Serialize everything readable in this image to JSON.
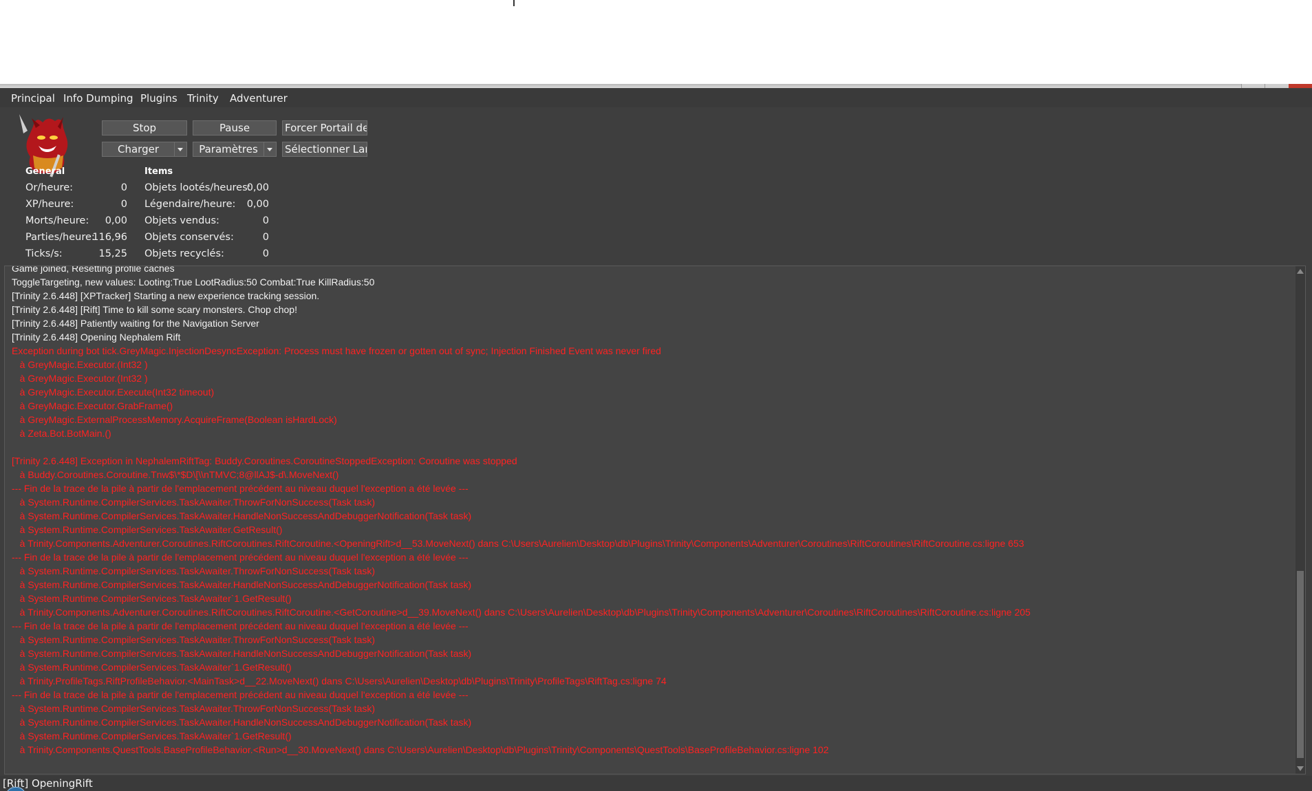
{
  "menu": [
    "Principal",
    "Info Dumping",
    "Plugins",
    "Trinity",
    "Adventurer"
  ],
  "toolbar": {
    "stop": "Stop",
    "pause": "Pause",
    "force_portal": "Forcer Portail de V",
    "load": "Charger",
    "settings": "Paramètres",
    "language": "Sélectionner Langa"
  },
  "stats": {
    "general_header": "General",
    "items_header": "Items",
    "general": [
      {
        "label": "Or/heure:",
        "value": "0"
      },
      {
        "label": "XP/heure:",
        "value": "0"
      },
      {
        "label": "Morts/heure:",
        "value": "0,00"
      },
      {
        "label": "Parties/heure:",
        "value": "116,96"
      },
      {
        "label": "Ticks/s:",
        "value": "15,25"
      }
    ],
    "items": [
      {
        "label": "Objets lootés/heures:",
        "value": "0,00"
      },
      {
        "label": "Légendaire/heure:",
        "value": "0,00"
      },
      {
        "label": "Objets vendus:",
        "value": "0"
      },
      {
        "label": "Objets conservés:",
        "value": "0"
      },
      {
        "label": "Objets recyclés:",
        "value": "0"
      }
    ]
  },
  "log": [
    {
      "level": "info",
      "text": "Game joined, Resetting profile caches"
    },
    {
      "level": "info",
      "text": "ToggleTargeting, new values: Looting:True LootRadius:50 Combat:True KillRadius:50"
    },
    {
      "level": "info",
      "text": "[Trinity 2.6.448] [XPTracker] Starting a new experience tracking session."
    },
    {
      "level": "info",
      "text": "[Trinity 2.6.448] [Rift] Time to kill some scary monsters. Chop chop!"
    },
    {
      "level": "info",
      "text": "[Trinity 2.6.448] Patiently waiting for the Navigation Server"
    },
    {
      "level": "info",
      "text": "[Trinity 2.6.448] Opening Nephalem Rift"
    },
    {
      "level": "err",
      "text": "Exception during bot tick.GreyMagic.InjectionDesyncException: Process must have frozen or gotten out of sync; Injection Finished Event was never fired"
    },
    {
      "level": "err",
      "text": "   à GreyMagic.Executor.(Int32 )"
    },
    {
      "level": "err",
      "text": "   à GreyMagic.Executor.(Int32 )"
    },
    {
      "level": "err",
      "text": "   à GreyMagic.Executor.Execute(Int32 timeout)"
    },
    {
      "level": "err",
      "text": "   à GreyMagic.Executor.GrabFrame()"
    },
    {
      "level": "err",
      "text": "   à GreyMagic.ExternalProcessMemory.AcquireFrame(Boolean isHardLock)"
    },
    {
      "level": "err",
      "text": "   à Zeta.Bot.BotMain.()"
    },
    {
      "level": "err",
      "text": ""
    },
    {
      "level": "err",
      "text": "[Trinity 2.6.448] Exception in NephalemRiftTag: Buddy.Coroutines.CoroutineStoppedException: Coroutine was stopped"
    },
    {
      "level": "err",
      "text": "   à Buddy.Coroutines.Coroutine.Tnw$\\*$D\\[\\\\nTMVC;8@llAJ$-d\\.MoveNext()"
    },
    {
      "level": "err",
      "text": "--- Fin de la trace de la pile à partir de l'emplacement précédent au niveau duquel l'exception a été levée ---"
    },
    {
      "level": "err",
      "text": "   à System.Runtime.CompilerServices.TaskAwaiter.ThrowForNonSuccess(Task task)"
    },
    {
      "level": "err",
      "text": "   à System.Runtime.CompilerServices.TaskAwaiter.HandleNonSuccessAndDebuggerNotification(Task task)"
    },
    {
      "level": "err",
      "text": "   à System.Runtime.CompilerServices.TaskAwaiter.GetResult()"
    },
    {
      "level": "err",
      "text": "   à Trinity.Components.Adventurer.Coroutines.RiftCoroutines.RiftCoroutine.<OpeningRift>d__53.MoveNext() dans C:\\Users\\Aurelien\\Desktop\\db\\Plugins\\Trinity\\Components\\Adventurer\\Coroutines\\RiftCoroutines\\RiftCoroutine.cs:ligne 653"
    },
    {
      "level": "err",
      "text": "--- Fin de la trace de la pile à partir de l'emplacement précédent au niveau duquel l'exception a été levée ---"
    },
    {
      "level": "err",
      "text": "   à System.Runtime.CompilerServices.TaskAwaiter.ThrowForNonSuccess(Task task)"
    },
    {
      "level": "err",
      "text": "   à System.Runtime.CompilerServices.TaskAwaiter.HandleNonSuccessAndDebuggerNotification(Task task)"
    },
    {
      "level": "err",
      "text": "   à System.Runtime.CompilerServices.TaskAwaiter`1.GetResult()"
    },
    {
      "level": "err",
      "text": "   à Trinity.Components.Adventurer.Coroutines.RiftCoroutines.RiftCoroutine.<GetCoroutine>d__39.MoveNext() dans C:\\Users\\Aurelien\\Desktop\\db\\Plugins\\Trinity\\Components\\Adventurer\\Coroutines\\RiftCoroutines\\RiftCoroutine.cs:ligne 205"
    },
    {
      "level": "err",
      "text": "--- Fin de la trace de la pile à partir de l'emplacement précédent au niveau duquel l'exception a été levée ---"
    },
    {
      "level": "err",
      "text": "   à System.Runtime.CompilerServices.TaskAwaiter.ThrowForNonSuccess(Task task)"
    },
    {
      "level": "err",
      "text": "   à System.Runtime.CompilerServices.TaskAwaiter.HandleNonSuccessAndDebuggerNotification(Task task)"
    },
    {
      "level": "err",
      "text": "   à System.Runtime.CompilerServices.TaskAwaiter`1.GetResult()"
    },
    {
      "level": "err",
      "text": "   à Trinity.ProfileTags.RiftProfileBehavior.<MainTask>d__22.MoveNext() dans C:\\Users\\Aurelien\\Desktop\\db\\Plugins\\Trinity\\ProfileTags\\RiftTag.cs:ligne 74"
    },
    {
      "level": "err",
      "text": "--- Fin de la trace de la pile à partir de l'emplacement précédent au niveau duquel l'exception a été levée ---"
    },
    {
      "level": "err",
      "text": "   à System.Runtime.CompilerServices.TaskAwaiter.ThrowForNonSuccess(Task task)"
    },
    {
      "level": "err",
      "text": "   à System.Runtime.CompilerServices.TaskAwaiter.HandleNonSuccessAndDebuggerNotification(Task task)"
    },
    {
      "level": "err",
      "text": "   à System.Runtime.CompilerServices.TaskAwaiter`1.GetResult()"
    },
    {
      "level": "err",
      "text": "   à Trinity.Components.QuestTools.BaseProfileBehavior.<Run>d__30.MoveNext() dans C:\\Users\\Aurelien\\Desktop\\db\\Plugins\\Trinity\\Components\\QuestTools\\BaseProfileBehavior.cs:ligne 102"
    }
  ],
  "status": {
    "text": "[Rift] OpeningRift"
  },
  "colors": {
    "background": "#3e3e3e",
    "error_text": "#ff2222",
    "info_text": "#f2f2f2"
  }
}
